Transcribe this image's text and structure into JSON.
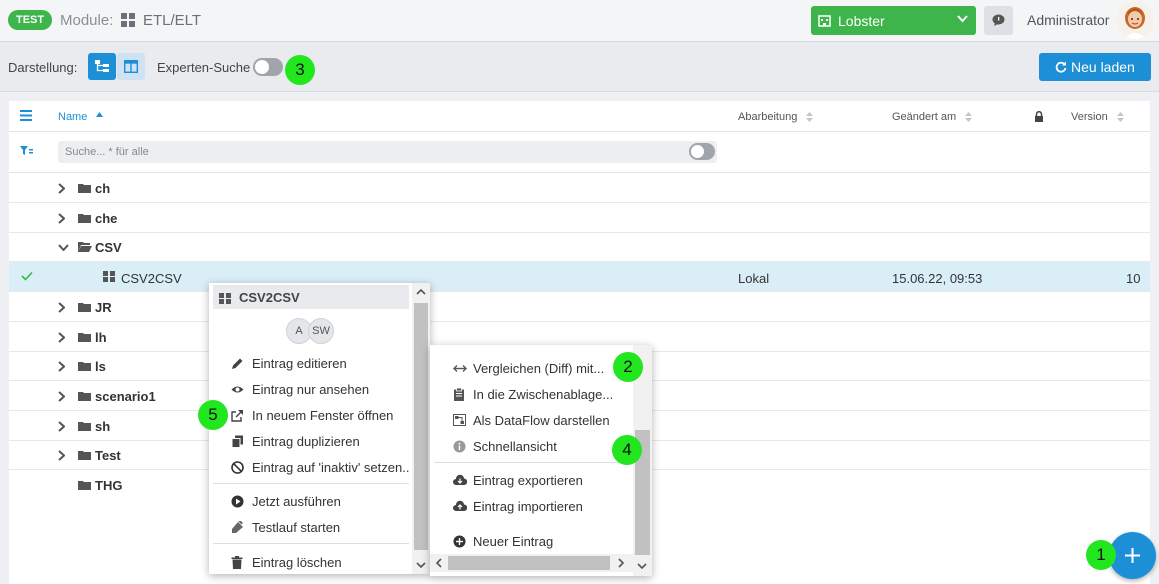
{
  "topbar": {
    "env_badge": "TEST",
    "module_label": "Module:",
    "module_name": "ETL/ELT",
    "tenant": "Lobster",
    "user_name": "Administrator"
  },
  "toolbar": {
    "view_label": "Darstellung:",
    "expert_search_label": "Experten-Suche",
    "expert_search_on": false,
    "reload_label": "Neu laden"
  },
  "table": {
    "columns": {
      "name": "Name",
      "processing": "Abarbeitung",
      "changed": "Geändert am",
      "version": "Version"
    },
    "search_placeholder": "Suche... * für alle",
    "folders_top": [
      "ch",
      "che"
    ],
    "open_folder": "CSV",
    "selected_item": {
      "name": "CSV2CSV",
      "processing": "Lokal",
      "changed": "15.06.22, 09:53",
      "version": "10"
    },
    "folders_bottom": [
      "JR",
      "lh",
      "ls",
      "scenario1",
      "sh",
      "Test",
      "THG"
    ]
  },
  "context_menu": {
    "title": "CSV2CSV",
    "chips": [
      "A",
      "SW"
    ],
    "items": [
      {
        "label": "Eintrag editieren",
        "icon": "pencil-icon"
      },
      {
        "label": "Eintrag nur ansehen",
        "icon": "eye-icon"
      },
      {
        "label": "In neuem Fenster öffnen",
        "icon": "external-link-icon"
      },
      {
        "label": "Eintrag duplizieren",
        "icon": "copy-icon"
      },
      {
        "label": "Eintrag auf 'inaktiv' setzen..",
        "icon": "ban-icon"
      },
      {
        "label": "Jetzt ausführen",
        "icon": "play-icon"
      },
      {
        "label": "Testlauf starten",
        "icon": "flask-icon"
      },
      {
        "label": "Eintrag löschen",
        "icon": "trash-icon"
      }
    ]
  },
  "submenu": {
    "items": [
      {
        "label": "Vergleichen (Diff) mit...",
        "icon": "diff-icon"
      },
      {
        "label": "In die Zwischenablage...",
        "icon": "clipboard-icon"
      },
      {
        "label": "Als DataFlow darstellen",
        "icon": "dataflow-icon"
      },
      {
        "label": "Schnellansicht",
        "icon": "info-icon"
      },
      {
        "label": "Eintrag exportieren",
        "icon": "cloud-download-icon"
      },
      {
        "label": "Eintrag importieren",
        "icon": "cloud-upload-icon"
      },
      {
        "label": "Neuer Eintrag",
        "icon": "plus-circle-icon"
      }
    ]
  },
  "markers": [
    "1",
    "2",
    "3",
    "4",
    "5"
  ],
  "colors": {
    "accent": "#1c8fd6",
    "success": "#3db54a",
    "marker": "#22e61e",
    "selected_row": "#d9eef7"
  }
}
